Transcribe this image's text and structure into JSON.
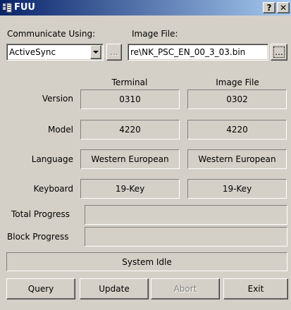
{
  "window": {
    "title": "FUU",
    "help_label": "?",
    "close_label": "✕"
  },
  "connection": {
    "label": "Communicate Using:",
    "selected": "ActiveSync",
    "browse_label": "..."
  },
  "image_file": {
    "label": "Image File:",
    "value": "re\\NK_PSC_EN_00_3_03.bin",
    "browse_label": "..."
  },
  "columns": {
    "terminal": "Terminal",
    "image_file": "Image File"
  },
  "rows": [
    {
      "label": "Version",
      "terminal": "0310",
      "image_file": "0302"
    },
    {
      "label": "Model",
      "terminal": "4220",
      "image_file": "4220"
    },
    {
      "label": "Language",
      "terminal": "Western European",
      "image_file": "Western European"
    },
    {
      "label": "Keyboard",
      "terminal": "19-Key",
      "image_file": "19-Key"
    }
  ],
  "progress": {
    "total_label": "Total Progress",
    "total_value": 0,
    "block_label": "Block Progress",
    "block_value": 0
  },
  "status": "System Idle",
  "buttons": {
    "query": "Query",
    "update": "Update",
    "abort": "Abort",
    "exit": "Exit"
  }
}
